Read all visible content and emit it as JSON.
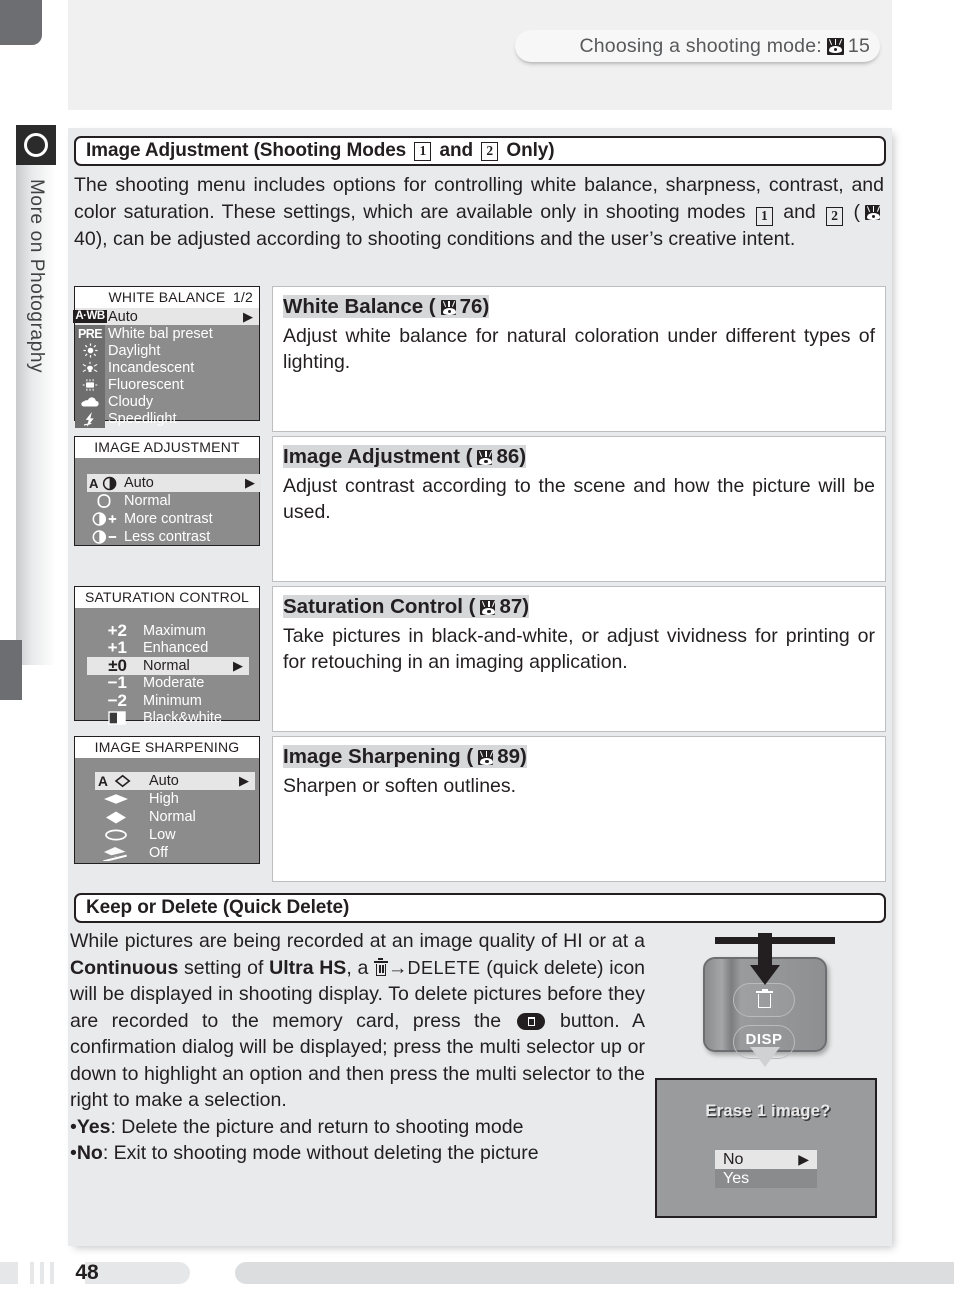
{
  "header": {
    "title_text": "Choosing a shooting mode:",
    "ref_page": "15",
    "icon": "eye-reference-icon"
  },
  "sidebar": {
    "label": "More on Photography",
    "icon": "circle-icon"
  },
  "section1": {
    "title_pre": "Image Adjustment (Shooting Modes",
    "mode_a": "1",
    "title_mid": "and",
    "mode_b": "2",
    "title_post": "Only)",
    "intro_p1": "The shooting menu includes options for controlling white balance, sharpness, contrast, and color saturation.  These settings, which are available only in shooting modes",
    "intro_and": "and",
    "intro_p2": "40), can be adjusted according to shooting conditions and the user’s creative intent.",
    "intro_ref": "40"
  },
  "menus": [
    {
      "key": "white-balance",
      "lcd_title": "WHITE BALANCE",
      "lcd_page": "1/2",
      "items": [
        {
          "icon": "a-wb-badge-icon",
          "icon_text": "A·WB",
          "label": "Auto",
          "selected": true,
          "arrow": "▶"
        },
        {
          "icon": "pre-badge-icon",
          "icon_text": "PRE",
          "label": "White bal preset",
          "selected": false,
          "arrow": ""
        },
        {
          "icon": "sun-icon",
          "icon_text": "",
          "label": "Daylight",
          "selected": false,
          "arrow": ""
        },
        {
          "icon": "incandescent-lamp-icon",
          "icon_text": "",
          "label": "Incandescent",
          "selected": false,
          "arrow": ""
        },
        {
          "icon": "fluorescent-tube-icon",
          "icon_text": "",
          "label": "Fluorescent",
          "selected": false,
          "arrow": ""
        },
        {
          "icon": "cloud-icon",
          "icon_text": "",
          "label": "Cloudy",
          "selected": false,
          "arrow": ""
        },
        {
          "icon": "speedlight-flash-icon",
          "icon_text": "",
          "label": "Speedlight",
          "selected": false,
          "arrow": ""
        }
      ],
      "desc_heading": "White Balance (",
      "desc_ref": "76",
      "desc_heading_end": ")",
      "desc_body": "Adjust white balance for natural coloration under different types of lighting."
    },
    {
      "key": "image-adjustment",
      "lcd_title": "IMAGE ADJUSTMENT",
      "lcd_page": "",
      "items": [
        {
          "icon": "auto-contrast-icon",
          "icon_text": "A",
          "label": "Auto",
          "selected": true,
          "arrow": "▶"
        },
        {
          "icon": "normal-contrast-icon",
          "icon_text": "",
          "label": "Normal",
          "selected": false,
          "arrow": ""
        },
        {
          "icon": "more-contrast-icon",
          "icon_text": "+",
          "label": "More contrast",
          "selected": false,
          "arrow": ""
        },
        {
          "icon": "less-contrast-icon",
          "icon_text": "−",
          "label": "Less contrast",
          "selected": false,
          "arrow": ""
        }
      ],
      "desc_heading": "Image Adjustment (",
      "desc_ref": "86",
      "desc_heading_end": ")",
      "desc_body": "Adjust contrast according to the scene and how the picture will be used."
    },
    {
      "key": "saturation-control",
      "lcd_title": "SATURATION CONTROL",
      "lcd_page": "",
      "items": [
        {
          "icon": "plus-two-icon",
          "icon_text": "+2",
          "label": "Maximum",
          "selected": false,
          "arrow": ""
        },
        {
          "icon": "plus-one-icon",
          "icon_text": "+1",
          "label": "Enhanced",
          "selected": false,
          "arrow": ""
        },
        {
          "icon": "plus-minus-zero-icon",
          "icon_text": "±0",
          "label": "Normal",
          "selected": true,
          "arrow": "▶"
        },
        {
          "icon": "minus-one-icon",
          "icon_text": "−1",
          "label": "Moderate",
          "selected": false,
          "arrow": ""
        },
        {
          "icon": "minus-two-icon",
          "icon_text": "−2",
          "label": "Minimum",
          "selected": false,
          "arrow": ""
        },
        {
          "icon": "black-and-white-icon",
          "icon_text": "",
          "label": "Black&white",
          "selected": false,
          "arrow": ""
        }
      ],
      "desc_heading": "Saturation Control (",
      "desc_ref": "87",
      "desc_heading_end": ")",
      "desc_body": "Take pictures in black-and-white, or adjust vividness for printing or for retouching in an imaging application."
    },
    {
      "key": "image-sharpening",
      "lcd_title": "IMAGE SHARPENING",
      "lcd_page": "",
      "items": [
        {
          "icon": "auto-sharpen-icon",
          "icon_text": "A",
          "label": "Auto",
          "selected": true,
          "arrow": "▶"
        },
        {
          "icon": "high-sharpen-icon",
          "icon_text": "",
          "label": "High",
          "selected": false,
          "arrow": ""
        },
        {
          "icon": "normal-sharpen-icon",
          "icon_text": "",
          "label": "Normal",
          "selected": false,
          "arrow": ""
        },
        {
          "icon": "low-sharpen-icon",
          "icon_text": "",
          "label": "Low",
          "selected": false,
          "arrow": ""
        },
        {
          "icon": "off-sharpen-icon",
          "icon_text": "",
          "label": "Off",
          "selected": false,
          "arrow": ""
        }
      ],
      "desc_heading": "Image Sharpening (",
      "desc_ref": "89",
      "desc_heading_end": ")",
      "desc_body": "Sharpen or soften outlines."
    }
  ],
  "section2": {
    "title": "Keep or Delete (Quick Delete)",
    "body_a": "While pictures are being recorded at an image quality of HI or at a ",
    "bold_continuous": "Continuous",
    "body_b": " setting of ",
    "bold_ultrahs": "Ultra HS",
    "body_c": ", a ",
    "delete_word": "DELETE",
    "body_d": " (quick delete) icon will be displayed in shooting display.  To delete pictures before they are recorded to the memory card, press the ",
    "body_e": " button.  A confirmation dialog will be displayed; press the multi selector up or down to highlight an option and then press the multi selector to the right to make a selection.",
    "bullets": [
      {
        "term": "Yes",
        "text": ": Delete the picture and return to shooting mode"
      },
      {
        "term": "No",
        "text": ": Exit to shooting mode without deleting the picture"
      }
    ]
  },
  "camera_illustration": {
    "trash_button_icon": "trash-button-icon",
    "disp_button_label": "DISP",
    "press_arrow_icon": "arrow-down-icon"
  },
  "erase_dialog": {
    "title": "Erase 1 image?",
    "options": [
      {
        "label": "No",
        "selected": true,
        "arrow": "▶"
      },
      {
        "label": "Yes",
        "selected": false,
        "arrow": ""
      }
    ]
  },
  "footer": {
    "page_number": "48"
  },
  "colors": {
    "page_bg": "#ffffff",
    "panel_bg": "#e9eaeb",
    "lcd_bg": "#8c8c8c",
    "lcd_icon_col": "#6e6e6e",
    "lcd_selected": "#e6e6e6",
    "text": "#231f20",
    "heading_highlight": "#d6d7d9",
    "sidebar_dark": "#2b2b2b"
  }
}
